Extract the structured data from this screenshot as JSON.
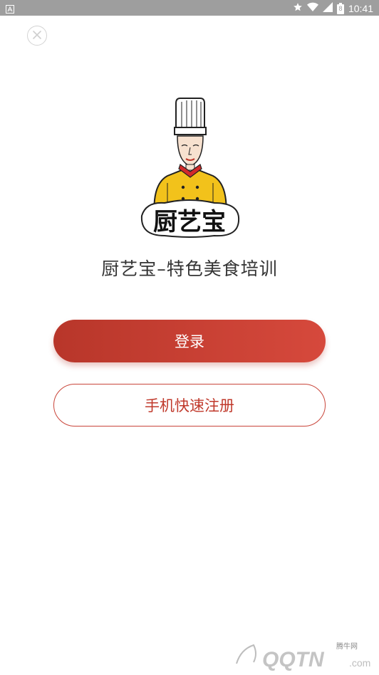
{
  "status_bar": {
    "time": "10:41",
    "battery_level": "8",
    "left_icon": "notification-a-icon",
    "icons": [
      "star-icon",
      "wifi-icon",
      "signal-icon",
      "battery-icon"
    ]
  },
  "close_icon": "close-icon",
  "logo": {
    "text": "厨艺宝"
  },
  "app_title": "厨艺宝–特色美食培训",
  "buttons": {
    "login_label": "登录",
    "register_label": "手机快速注册"
  },
  "watermark": {
    "brand": "QQTN",
    "suffix": ".com",
    "cn": "腾牛网"
  },
  "colors": {
    "accent": "#c0392b",
    "accent_dark": "#b8362a",
    "accent_light": "#d6493c",
    "chef_yellow": "#f2c21b",
    "status_bar_bg": "#9e9e9e"
  }
}
